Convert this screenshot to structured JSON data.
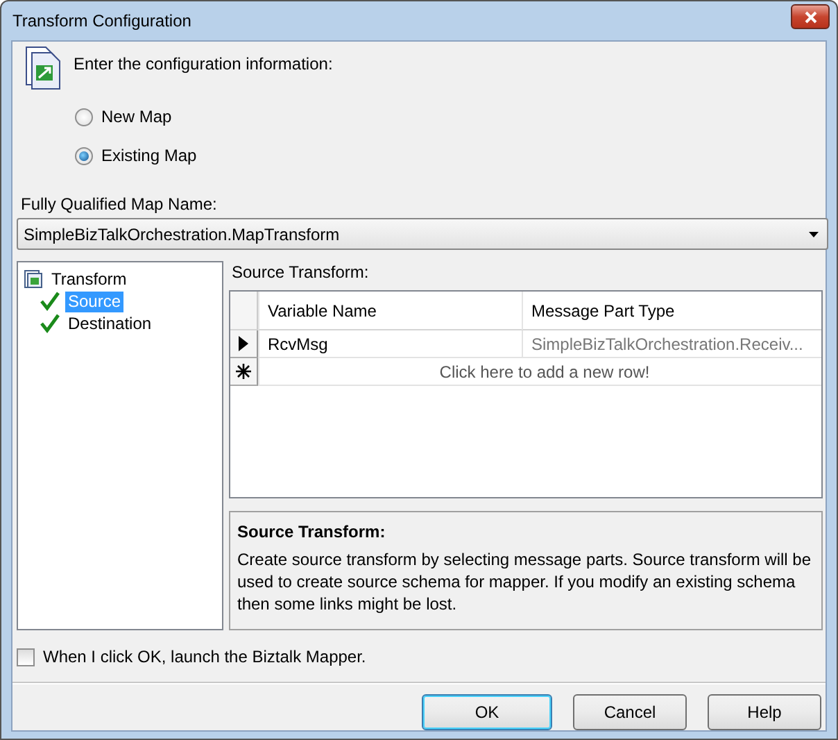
{
  "window": {
    "title": "Transform Configuration"
  },
  "instruction": "Enter the configuration information:",
  "map_options": [
    {
      "label": "New Map",
      "selected": false
    },
    {
      "label": "Existing Map",
      "selected": true
    }
  ],
  "map_name": {
    "label": "Fully Qualified Map Name:",
    "value": "SimpleBizTalkOrchestration.MapTransform"
  },
  "tree": [
    {
      "label": "Transform",
      "selected": false,
      "children": [
        {
          "label": "Source",
          "selected": true,
          "checked": true
        },
        {
          "label": "Destination",
          "selected": false,
          "checked": true
        }
      ]
    }
  ],
  "grid": {
    "label": "Source Transform:",
    "columns": [
      "Variable Name",
      "Message Part Type"
    ],
    "rows": [
      {
        "cells": [
          "RcvMsg",
          "SimpleBizTalkOrchestration.Receiv..."
        ],
        "current": true
      }
    ],
    "new_row": "Click here to add a new row!"
  },
  "description": {
    "title": "Source Transform:",
    "text": "Create source transform by selecting message parts. Source transform will be used to create source schema for mapper. If you modify an existing schema then some links might be lost."
  },
  "launch_mapper": {
    "label": "When I click OK, launch the Biztalk Mapper.",
    "checked": false
  },
  "buttons": [
    {
      "label": "OK",
      "default": true
    },
    {
      "label": "Cancel",
      "default": false
    },
    {
      "label": "Help",
      "default": false
    }
  ]
}
